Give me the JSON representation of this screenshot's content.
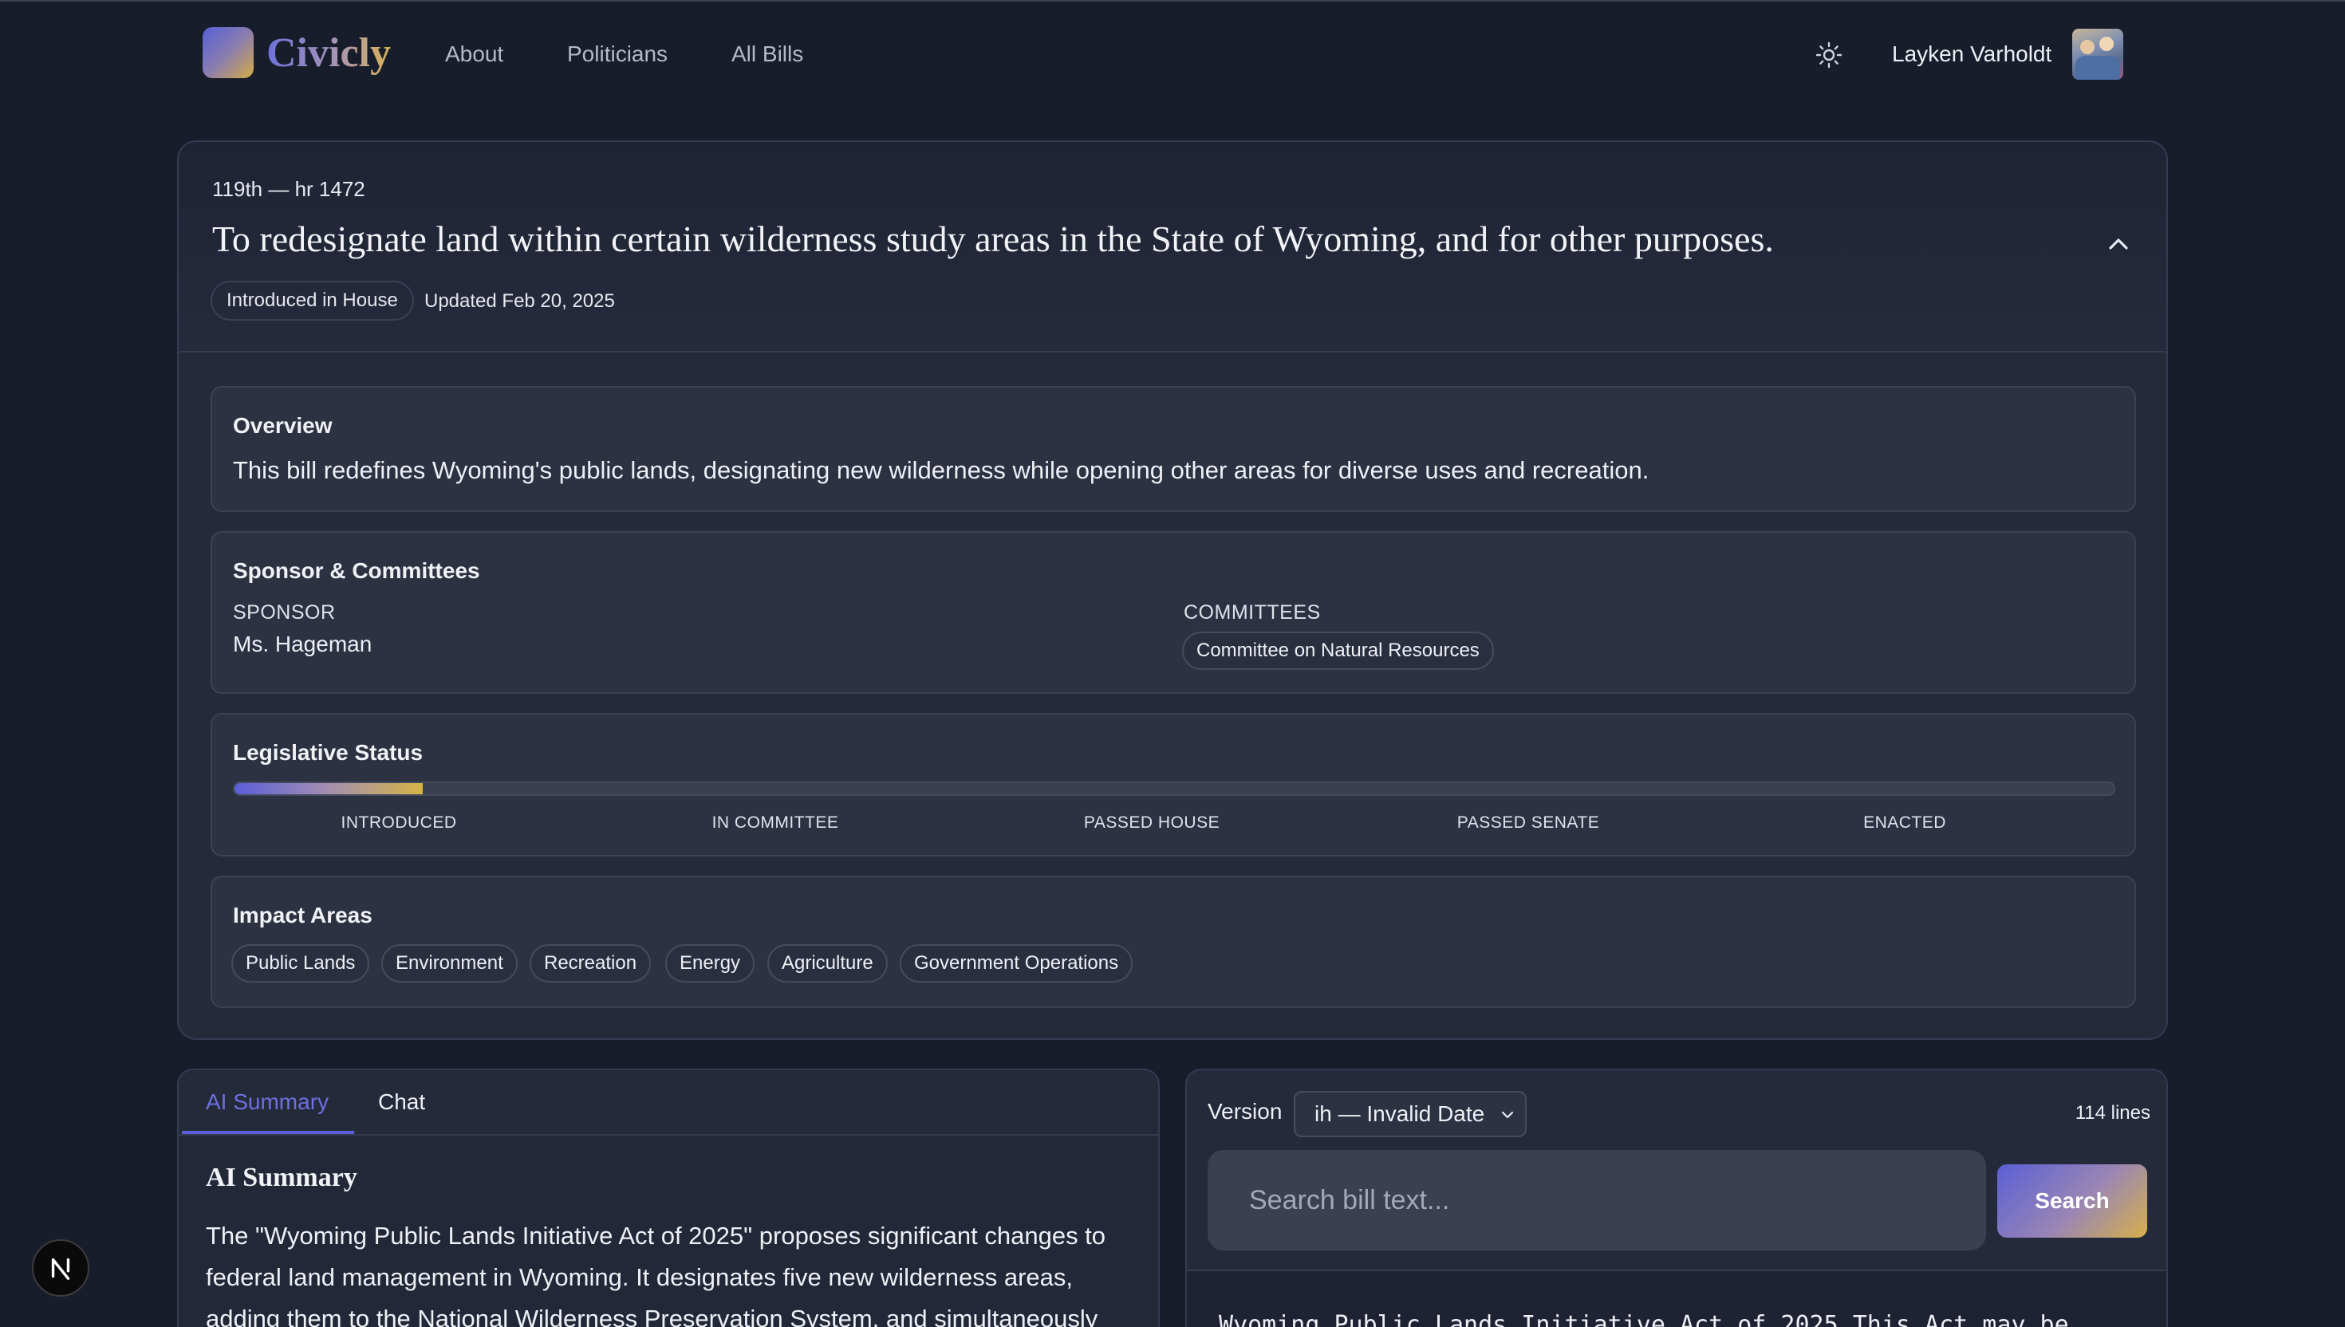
{
  "nav": {
    "brand": "Civicly",
    "links": [
      "About",
      "Politicians",
      "All Bills"
    ],
    "theme_icon": "sun-icon",
    "user_name": "Layken Varholdt"
  },
  "bill": {
    "id": "119th — hr 1472",
    "title": "To redesignate land within certain wilderness study areas in the State of Wyoming, and for other purposes.",
    "status_badge": "Introduced in House",
    "updated": "Updated Feb 20, 2025",
    "overview": {
      "title": "Overview",
      "text": "This bill redefines Wyoming's public lands, designating new wilderness while opening other areas for diverse uses and recreation."
    },
    "sponsor_committees": {
      "title": "Sponsor & Committees",
      "sponsor_label": "SPONSOR",
      "sponsor": "Ms. Hageman",
      "committees_label": "COMMITTEES",
      "committees": [
        "Committee on Natural Resources"
      ]
    },
    "legislative_status": {
      "title": "Legislative Status",
      "progress_fraction": 0.1,
      "stages": [
        "INTRODUCED",
        "IN COMMITTEE",
        "PASSED HOUSE",
        "PASSED SENATE",
        "ENACTED"
      ]
    },
    "impact_areas": {
      "title": "Impact Areas",
      "tags": [
        "Public Lands",
        "Environment",
        "Recreation",
        "Energy",
        "Agriculture",
        "Government Operations"
      ]
    }
  },
  "summary_panel": {
    "tabs": [
      "AI Summary",
      "Chat"
    ],
    "active_tab": "AI Summary",
    "heading": "AI Summary",
    "text": "The \"Wyoming Public Lands Initiative Act of 2025\" proposes significant changes to federal land management in Wyoming. It designates five new wilderness areas, adding them to the National Wilderness Preservation System, and simultaneously"
  },
  "text_panel": {
    "version_label": "Version",
    "version_selected": "ih — Invalid Date",
    "lines": "114 lines",
    "search_placeholder": "Search bill text...",
    "search_button": "Search",
    "bill_text": "Wyoming Public Lands Initiative Act of 2025 This Act may be"
  },
  "colors": {
    "background": "#181d2c",
    "accent": "#5b5fd8",
    "gold": "#d6b445"
  }
}
